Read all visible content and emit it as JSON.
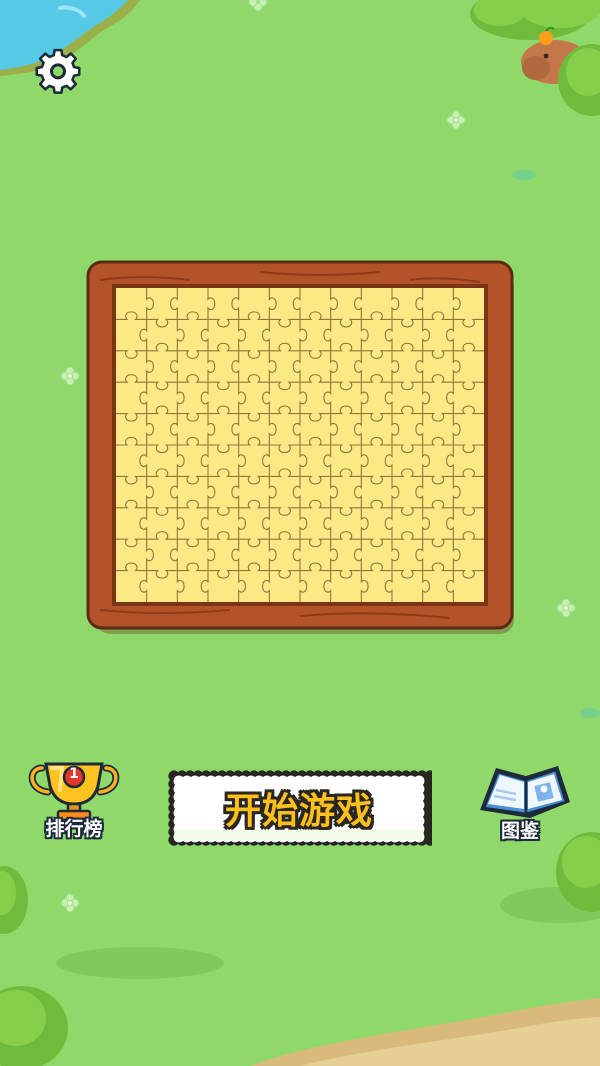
{
  "colors": {
    "grass": "#8fd96a",
    "water": "#56c9e6",
    "frame_wood": "#b4532a",
    "puzzle_fill": "#fbe986",
    "start_text": "#ffc01c"
  },
  "top_bar": {
    "settings_icon": "gear-icon"
  },
  "board": {
    "type": "jigsaw-preview",
    "columns": 12,
    "rows": 10
  },
  "menu": {
    "leaderboard": {
      "label": "排行榜",
      "icon": "trophy-icon",
      "rank_badge": "1"
    },
    "start": {
      "label": "开始游戏"
    },
    "album": {
      "label": "图鉴",
      "icon": "book-icon"
    }
  }
}
